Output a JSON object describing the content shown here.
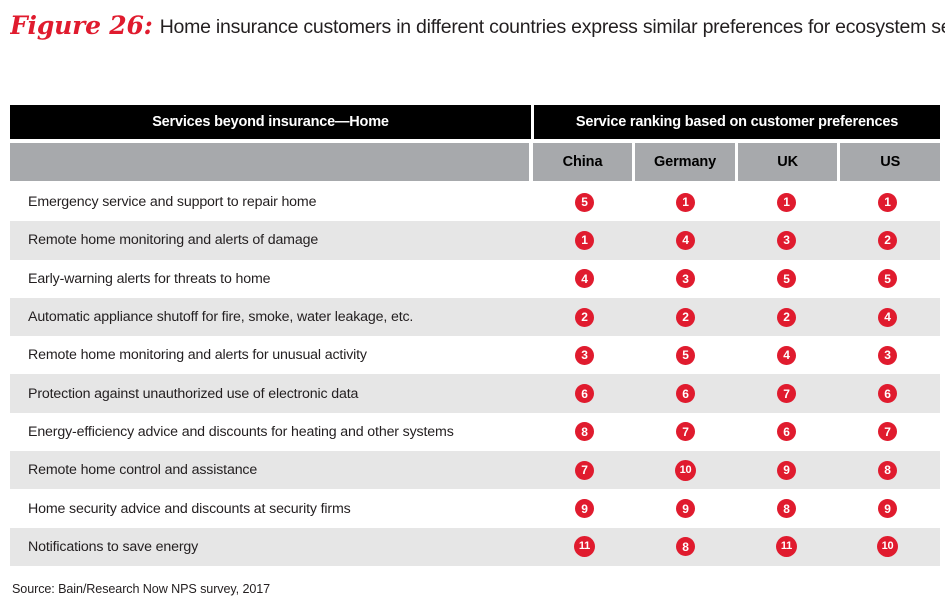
{
  "figure": {
    "label": "Figure 26:",
    "title": "Home insurance customers in different countries express similar preferences for ecosystem services…"
  },
  "table": {
    "header_left": "Services beyond insurance—Home",
    "header_right": "Service ranking based on customer preferences",
    "countries": [
      "China",
      "Germany",
      "UK",
      "US"
    ],
    "rows": [
      {
        "service": "Emergency service and support to repair home",
        "ranks": [
          "5",
          "1",
          "1",
          "1"
        ]
      },
      {
        "service": "Remote home monitoring and alerts of damage",
        "ranks": [
          "1",
          "4",
          "3",
          "2"
        ]
      },
      {
        "service": "Early-warning alerts for threats to home",
        "ranks": [
          "4",
          "3",
          "5",
          "5"
        ]
      },
      {
        "service": "Automatic appliance shutoff for fire, smoke, water leakage, etc.",
        "ranks": [
          "2",
          "2",
          "2",
          "4"
        ]
      },
      {
        "service": "Remote home monitoring and alerts for unusual activity",
        "ranks": [
          "3",
          "5",
          "4",
          "3"
        ]
      },
      {
        "service": "Protection against unauthorized use of electronic data",
        "ranks": [
          "6",
          "6",
          "7",
          "6"
        ]
      },
      {
        "service": "Energy-efficiency advice and discounts for heating and other systems",
        "ranks": [
          "8",
          "7",
          "6",
          "7"
        ]
      },
      {
        "service": "Remote home control and assistance",
        "ranks": [
          "7",
          "10",
          "9",
          "8"
        ]
      },
      {
        "service": "Home security advice and discounts at security firms",
        "ranks": [
          "9",
          "9",
          "8",
          "9"
        ]
      },
      {
        "service": "Notifications to save energy",
        "ranks": [
          "11",
          "8",
          "11",
          "10"
        ]
      }
    ]
  },
  "source": "Source: Bain/Research Now NPS survey, 2017",
  "colors": {
    "accent_red": "#e01b2e",
    "header_black": "#000000",
    "subheader_gray": "#a7a9ac",
    "row_alt_gray": "#e6e6e6",
    "text_dark": "#231f20"
  },
  "chart_data": {
    "type": "table",
    "title": "Home insurance customers in different countries express similar preferences for ecosystem services…",
    "categories": [
      "Emergency service and support to repair home",
      "Remote home monitoring and alerts of damage",
      "Early-warning alerts for threats to home",
      "Automatic appliance shutoff for fire, smoke, water leakage, etc.",
      "Remote home monitoring and alerts for unusual activity",
      "Protection against unauthorized use of electronic data",
      "Energy-efficiency advice and discounts for heating and other systems",
      "Remote home control and assistance",
      "Home security advice and discounts at security firms",
      "Notifications to save energy"
    ],
    "series": [
      {
        "name": "China",
        "values": [
          5,
          1,
          4,
          2,
          3,
          6,
          8,
          7,
          9,
          11
        ]
      },
      {
        "name": "Germany",
        "values": [
          1,
          4,
          3,
          2,
          5,
          6,
          7,
          10,
          9,
          8
        ]
      },
      {
        "name": "UK",
        "values": [
          1,
          3,
          5,
          2,
          4,
          7,
          6,
          9,
          8,
          11
        ]
      },
      {
        "name": "US",
        "values": [
          1,
          2,
          5,
          4,
          3,
          6,
          7,
          8,
          9,
          10
        ]
      }
    ],
    "xlabel": "Services beyond insurance—Home",
    "ylabel": "Service ranking based on customer preferences",
    "grid": false,
    "legend_position": "top"
  }
}
